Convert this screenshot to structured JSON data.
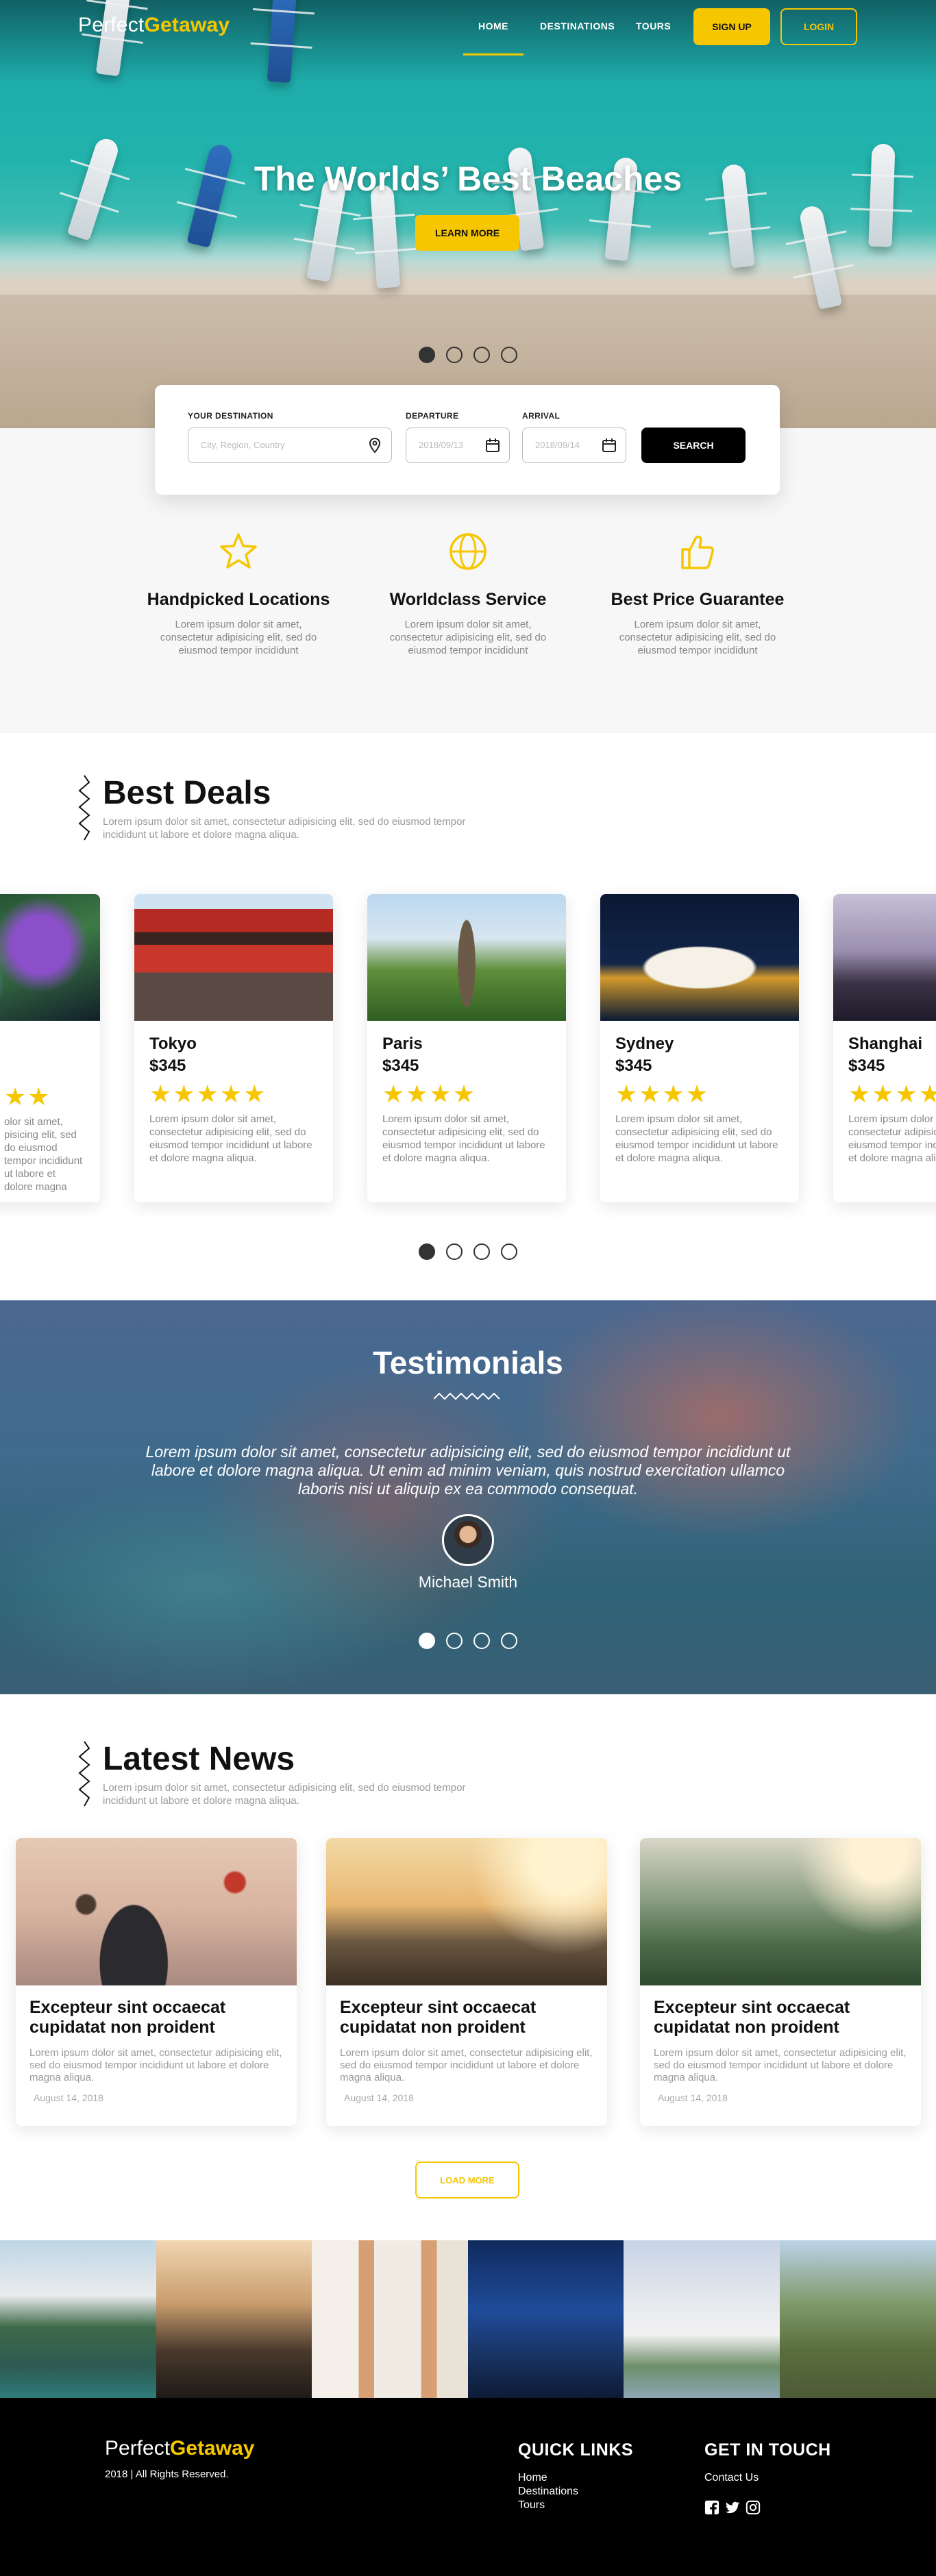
{
  "brand": {
    "name_a": "Perfect",
    "name_b": "Getaway",
    "accent": "#f6c700"
  },
  "nav": {
    "items": [
      "HOME",
      "DESTINATIONS",
      "TOURS"
    ],
    "signup": "SIGN UP",
    "login": "LOGIN"
  },
  "hero": {
    "title": "The Worlds’ Best Beaches",
    "cta": "LEARN MORE",
    "slides": 4,
    "active_slide": 1
  },
  "search": {
    "destination_label": "YOUR DESTINATION",
    "destination_placeholder": "City, Region, Country",
    "departure_label": "DEPARTURE",
    "departure_placeholder": "2018/09/13",
    "arrival_label": "ARRIVAL",
    "arrival_placeholder": "2018/09/14",
    "button": "SEARCH"
  },
  "features": [
    {
      "icon": "star-icon",
      "title": "Handpicked Locations",
      "text": "Lorem ipsum dolor sit amet, consectetur adipisicing elit, sed do eiusmod tempor incididunt"
    },
    {
      "icon": "globe-icon",
      "title": "Worldclass Service",
      "text": "Lorem ipsum dolor sit amet, consectetur adipisicing elit, sed do eiusmod tempor incididunt"
    },
    {
      "icon": "thumbs-up-icon",
      "title": "Best Price Guarantee",
      "text": "Lorem ipsum dolor sit amet, consectetur adipisicing elit, sed do eiusmod tempor incididunt"
    }
  ],
  "deals": {
    "title": "Best Deals",
    "subtitle": "Lorem ipsum dolor sit amet, consectetur adipisicing elit, sed do eiusmod tempor incididunt ut labore et dolore magna aliqua.",
    "partial_left": {
      "stars": "★★",
      "text": "olor sit amet, pisicing elit, sed do eiusmod tempor incididunt ut labore et dolore magna"
    },
    "cards": [
      {
        "city": "Tokyo",
        "price": "$345",
        "rating": 5,
        "stars": "★★★★★",
        "text": "Lorem ipsum dolor sit amet, consectetur adipisicing elit, sed do eiusmod tempor incididunt ut labore et dolore magna aliqua."
      },
      {
        "city": "Paris",
        "price": "$345",
        "rating": 4,
        "stars": "★★★★",
        "text": "Lorem ipsum dolor sit amet, consectetur adipisicing elit, sed do eiusmod tempor incididunt ut labore et dolore magna aliqua."
      },
      {
        "city": "Sydney",
        "price": "$345",
        "rating": 4,
        "stars": "★★★★",
        "text": "Lorem ipsum dolor sit amet, consectetur adipisicing elit, sed do eiusmod tempor incididunt ut labore et dolore magna aliqua."
      },
      {
        "city": "Shanghai",
        "price": "$345",
        "rating": 4,
        "stars": "★★★★",
        "text": "Lorem ipsum dolor sit amet, consectetur adipisicing elit, sed do eiusmod tempor incididunt ut labore et dolore magna aliqua."
      }
    ],
    "slides": 4,
    "active_slide": 1
  },
  "testimonials": {
    "title": "Testimonials",
    "quote": "Lorem ipsum dolor sit amet, consectetur adipisicing elit, sed do eiusmod tempor incididunt ut labore et dolore magna aliqua. Ut enim ad minim veniam, quis nostrud exercitation ullamco laboris nisi ut aliquip ex ea commodo consequat.",
    "author": "Michael Smith",
    "slides": 4,
    "active_slide": 1
  },
  "news": {
    "title": "Latest News",
    "subtitle": "Lorem ipsum dolor sit amet, consectetur adipisicing elit, sed do eiusmod tempor incididunt ut labore et dolore magna aliqua.",
    "cards": [
      {
        "headline": "Excepteur sint occaecat cupidatat non proident",
        "text": "Lorem ipsum dolor sit amet, consectetur adipisicing elit, sed do eiusmod tempor incididunt ut labore et dolore magna aliqua.",
        "date": "August 14, 2018"
      },
      {
        "headline": "Excepteur sint occaecat cupidatat non proident",
        "text": "Lorem ipsum dolor sit amet, consectetur adipisicing elit, sed do eiusmod tempor incididunt ut labore et dolore magna aliqua.",
        "date": "August 14, 2018"
      },
      {
        "headline": "Excepteur sint occaecat cupidatat non proident",
        "text": "Lorem ipsum dolor sit amet, consectetur adipisicing elit, sed do eiusmod tempor incididunt ut labore et dolore magna aliqua.",
        "date": "August 14, 2018"
      }
    ],
    "load_more": "LOAD MORE"
  },
  "footer": {
    "copyright": "2018 | All Rights Reserved.",
    "quick_links_title": "QUICK LINKS",
    "quick_links": [
      "Home",
      "Destinations",
      "Tours"
    ],
    "contact_title": "GET IN TOUCH",
    "contact_link": "Contact Us",
    "social": [
      "facebook-icon",
      "twitter-icon",
      "instagram-icon"
    ]
  }
}
